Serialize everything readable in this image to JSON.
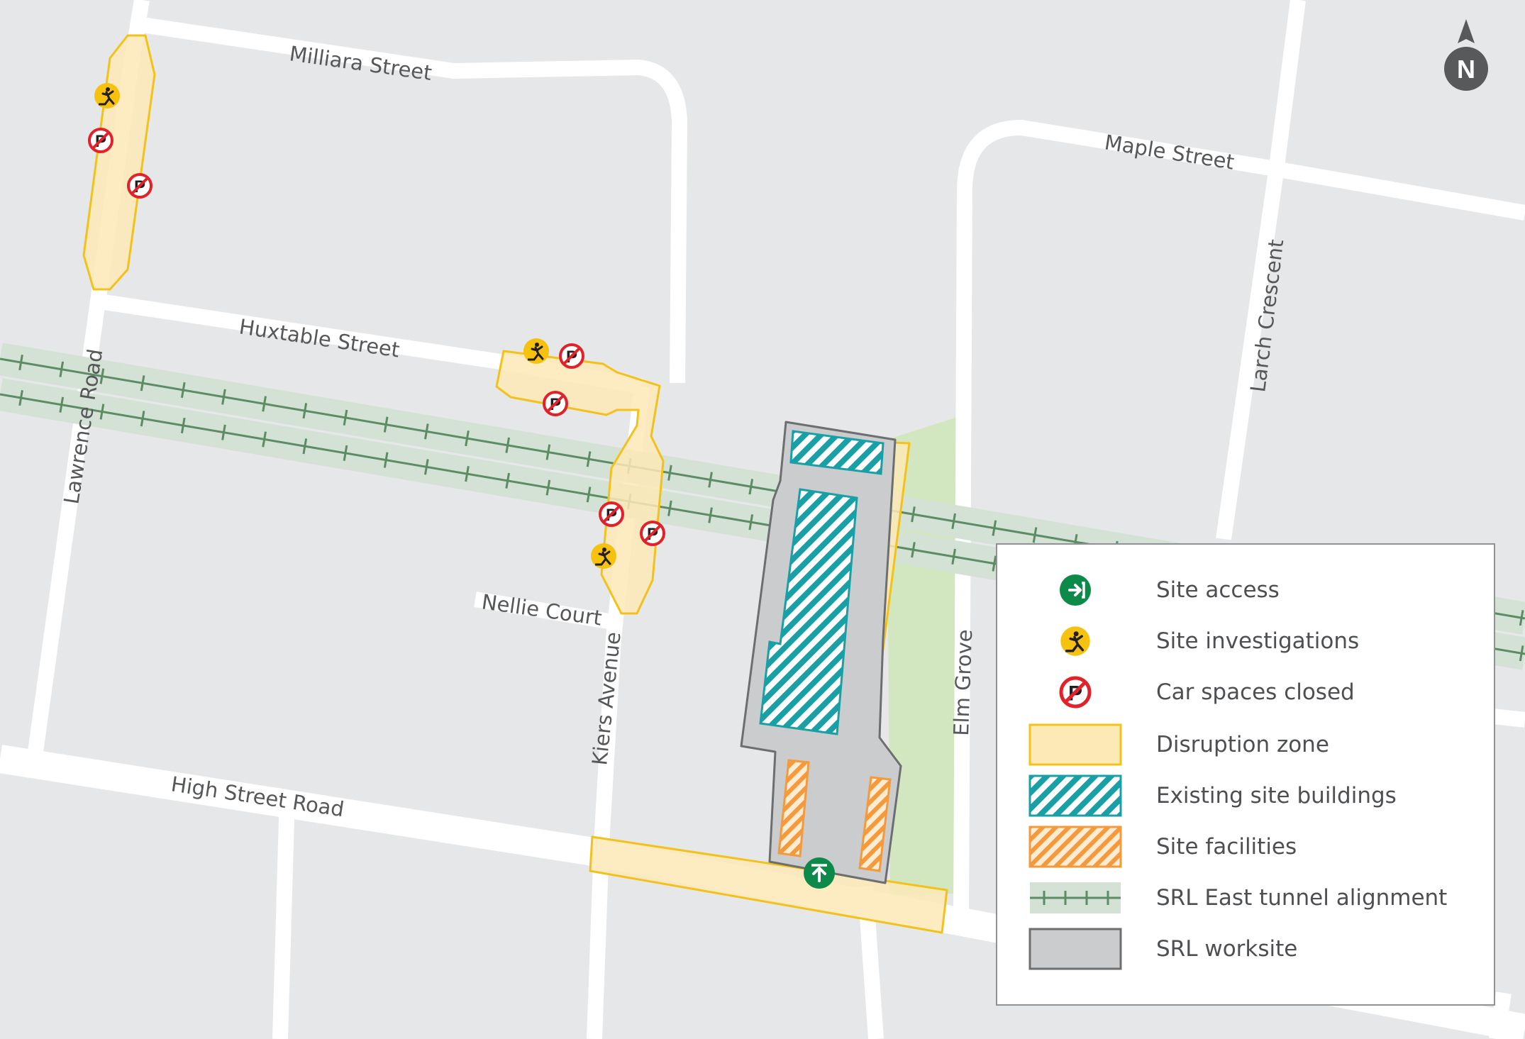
{
  "map": {
    "streets": [
      {
        "key": "milliara",
        "name": "Milliara Street"
      },
      {
        "key": "huxtable",
        "name": "Huxtable Street"
      },
      {
        "key": "lawrence",
        "name": "Lawrence Road"
      },
      {
        "key": "nellie",
        "name": "Nellie Court"
      },
      {
        "key": "kiers",
        "name": "Kiers Avenue"
      },
      {
        "key": "highstreet",
        "name": "High Street Road"
      },
      {
        "key": "maple",
        "name": "Maple Street"
      },
      {
        "key": "larch",
        "name": "Larch Crescent"
      },
      {
        "key": "elm",
        "name": "Elm Grove"
      }
    ],
    "north_label": "N"
  },
  "legend": {
    "items": [
      {
        "label": "Site access",
        "icon": "site-access-icon"
      },
      {
        "label": "Site investigations",
        "icon": "site-investigations-icon"
      },
      {
        "label": "Car spaces closed",
        "icon": "no-parking-icon"
      },
      {
        "label": "Disruption zone",
        "icon": "disruption-zone-swatch"
      },
      {
        "label": "Existing site buildings",
        "icon": "existing-buildings-swatch"
      },
      {
        "label": "Site facilities",
        "icon": "site-facilities-swatch"
      },
      {
        "label": "SRL East tunnel alignment",
        "icon": "tunnel-alignment-swatch"
      },
      {
        "label": "SRL worksite",
        "icon": "worksite-swatch"
      }
    ]
  },
  "colors": {
    "background": "#e6e7e8",
    "road": "#ffffff",
    "disruption_fill": "#fde9b6",
    "disruption_stroke": "#f2c21b",
    "buildings": "#19a0a6",
    "facilities": "#f59a3c",
    "tunnel": "#5c8c63",
    "tunnel_band": "#d3e2d4",
    "worksite": "#cbcccd",
    "worksite_stroke": "#6d6e70",
    "access_green": "#0d8a4a",
    "investigation_yellow": "#f6c10f",
    "no_parking_red": "#e2222b",
    "green_space": "#d2e6bf"
  }
}
